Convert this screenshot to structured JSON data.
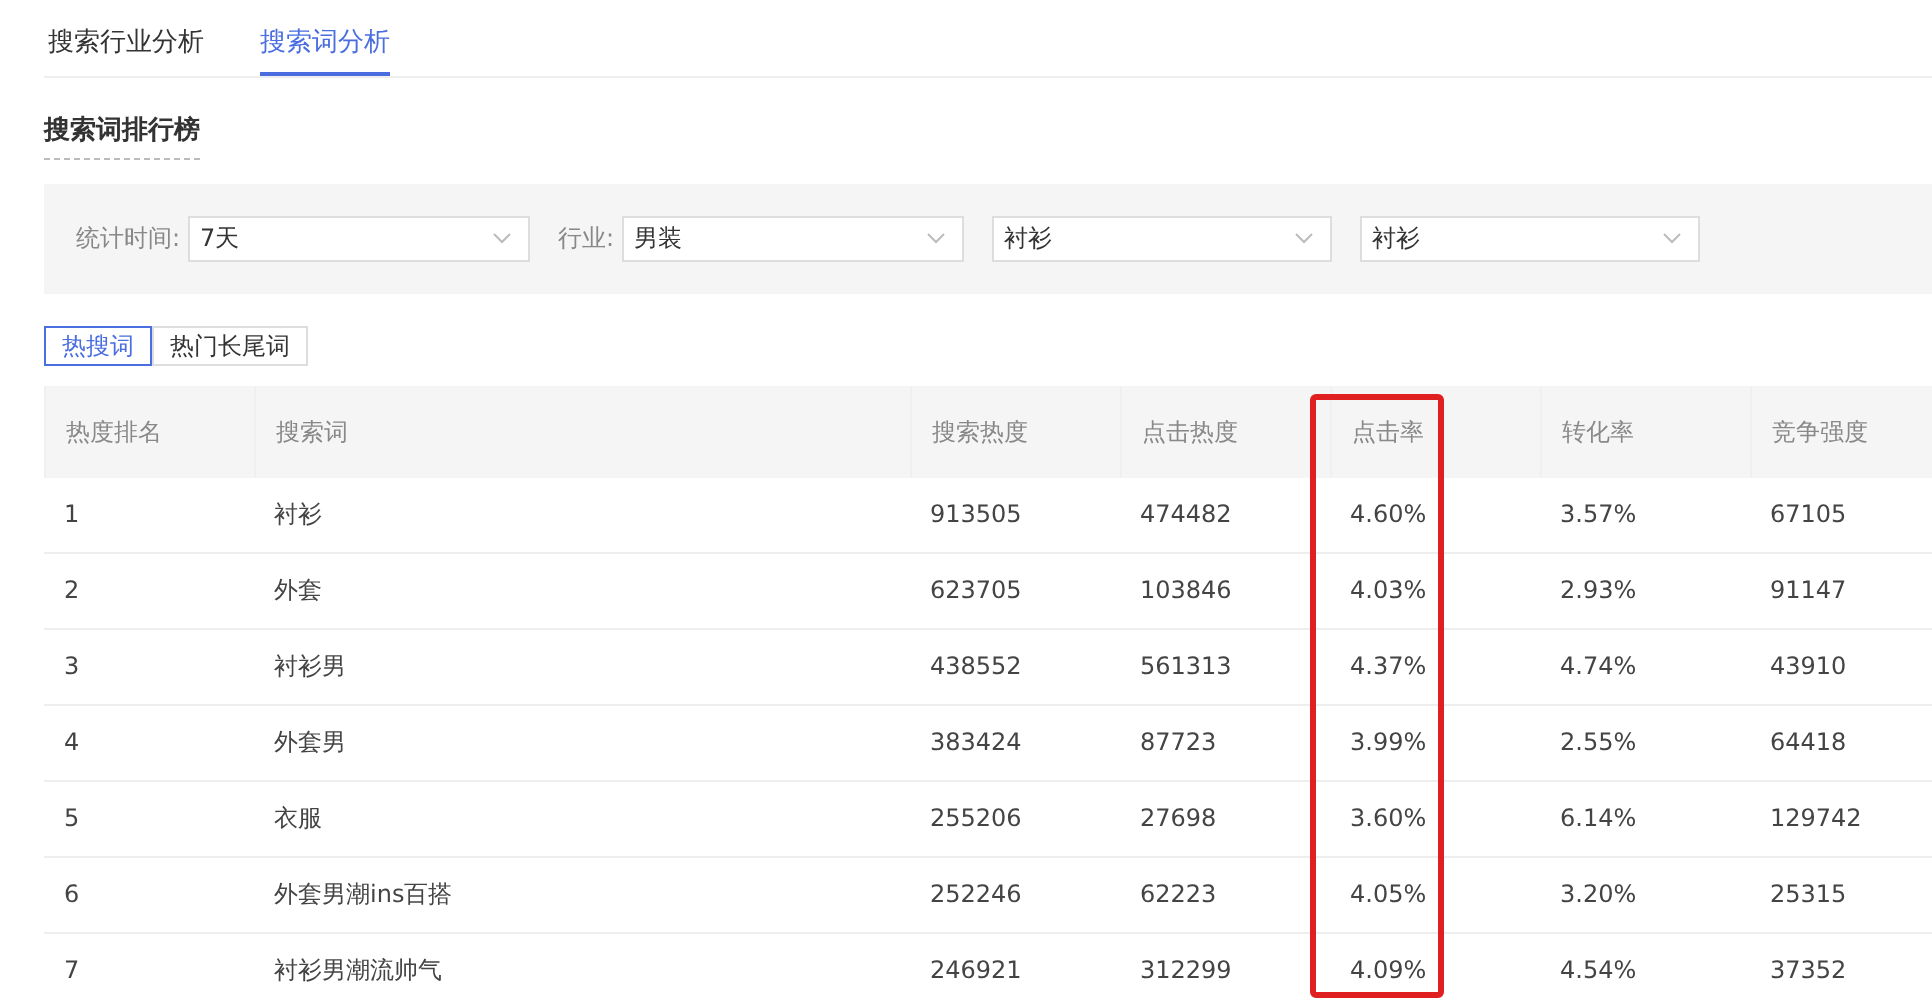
{
  "tabs": [
    {
      "label": "搜索行业分析",
      "selected": false
    },
    {
      "label": "搜索词分析",
      "selected": true
    }
  ],
  "section_title": "搜索词排行榜",
  "filters": [
    {
      "label": "统计时间:",
      "value": "7天"
    },
    {
      "label": "行业:",
      "value": "男装"
    },
    {
      "value": "衬衫"
    },
    {
      "value": "衬衫"
    }
  ],
  "segments": [
    {
      "label": "热搜词",
      "selected": true
    },
    {
      "label": "热门长尾词",
      "selected": false
    }
  ],
  "table": {
    "columns": [
      {
        "label": "热度排名",
        "highlighted": false
      },
      {
        "label": "搜索词",
        "highlighted": false
      },
      {
        "label": "搜索热度",
        "highlighted": false
      },
      {
        "label": "点击热度",
        "highlighted": false
      },
      {
        "label": "点击率",
        "highlighted": true
      },
      {
        "label": "转化率",
        "highlighted": false
      },
      {
        "label": "竞争强度",
        "highlighted": false
      }
    ],
    "rows": [
      [
        "1",
        "衬衫",
        "913505",
        "474482",
        "4.60%",
        "3.57%",
        "67105"
      ],
      [
        "2",
        "外套",
        "623705",
        "103846",
        "4.03%",
        "2.93%",
        "91147"
      ],
      [
        "3",
        "衬衫男",
        "438552",
        "561313",
        "4.37%",
        "4.74%",
        "43910"
      ],
      [
        "4",
        "外套男",
        "383424",
        "87723",
        "3.99%",
        "2.55%",
        "64418"
      ],
      [
        "5",
        "衣服",
        "255206",
        "27698",
        "3.60%",
        "6.14%",
        "129742"
      ],
      [
        "6",
        "外套男潮ins百搭",
        "252246",
        "62223",
        "4.05%",
        "3.20%",
        "25315"
      ],
      [
        "7",
        "衬衫男潮流帅气",
        "246921",
        "312299",
        "4.09%",
        "4.54%",
        "37352"
      ]
    ]
  }
}
